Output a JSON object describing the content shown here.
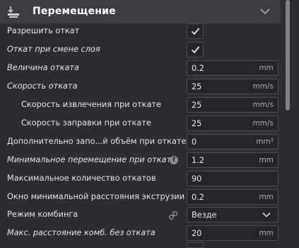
{
  "section": {
    "title": "Перемещение",
    "icon": "travel-icon"
  },
  "rows": [
    {
      "label": "Разрешить откат",
      "checked": true
    },
    {
      "label": "Откат при смене слоя",
      "checked": true
    },
    {
      "label": "Величина отката",
      "value": "0.2",
      "unit": "mm"
    },
    {
      "label": "Скорость отката",
      "value": "25",
      "unit": "mm/s"
    },
    {
      "label": "Скорость извлечения при откате",
      "value": "25",
      "unit": "mm/s"
    },
    {
      "label": "Скорость заправки при откате",
      "value": "25",
      "unit": "mm/s"
    },
    {
      "label": "Дополнительно запо...й объём при откате",
      "value": "0",
      "unit": "mm³"
    },
    {
      "label": "Минимальное перемещение при откате",
      "value": "1.2",
      "unit": "mm",
      "info_icon": "f"
    },
    {
      "label": "Максимальное количество откатов",
      "value": "90",
      "unit": ""
    },
    {
      "label": "Окно минимальной расстояния экструзии",
      "value": "0.2",
      "unit": "mm"
    },
    {
      "label": "Режим комбинга",
      "value": "Везде",
      "link_icon": "link-icon",
      "dropdown": true
    },
    {
      "label": "Макс. расстояние комб. без отката",
      "value": "20",
      "unit": "mm"
    }
  ],
  "colors": {
    "background": "#2b2d30",
    "header": "#3b3e42",
    "field_border": "#4a4d52"
  }
}
